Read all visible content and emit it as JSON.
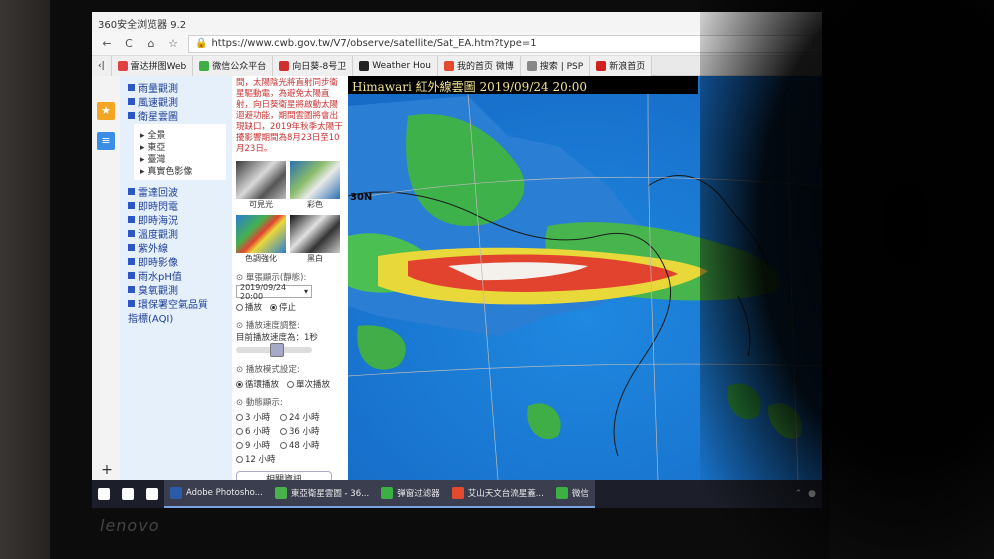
{
  "browser": {
    "title": "360安全浏览器 9.2",
    "url": "https://www.cwb.gov.tw/V7/observe/satellite/Sat_EA.htm?type=1",
    "nav_icons": [
      "back-icon",
      "refresh-icon",
      "home-icon",
      "star-icon"
    ],
    "tabs": [
      {
        "label": "雷达拼图Web",
        "color": "#e04040"
      },
      {
        "label": "微信公众平台",
        "color": "#3cb043"
      },
      {
        "label": "向日葵-8号卫",
        "color": "#d03030"
      },
      {
        "label": "Weather Hou",
        "color": "#222222"
      },
      {
        "label": "我的首页 微博",
        "color": "#e64a2e"
      },
      {
        "label": "搜索 | PSP",
        "color": "#888888"
      },
      {
        "label": "新浪首页",
        "color": "#d02020"
      }
    ]
  },
  "nav": {
    "items_top": [
      "雨量觀測",
      "風速觀測",
      "衛星雲圖"
    ],
    "sub_items": [
      "全景",
      "東亞",
      "臺灣",
      "真實色影像"
    ],
    "items_bottom": [
      "雷達回波",
      "即時閃電",
      "即時海況",
      "溫度觀測",
      "紫外線",
      "即時影像",
      "雨水pH值",
      "臭氧觀測",
      "環保署空氣品質"
    ],
    "items_tail": "指標(AQI)"
  },
  "controls": {
    "note": "間，太陽陰光將直射同步衛星驅動電，為避免太陽直射，向日葵衛星將啟動太陽迴避功能，期間雲圖將會出現缺口，2019年秋季太陽干擾影響期間為8月23日至10月23日。",
    "thumbs": [
      "可見光",
      "彩色",
      "色調強化",
      "黑白"
    ],
    "single_frame_label": "單張顯示(靜態):",
    "selected_time": "2019/09/24 20:00",
    "play_radio": "播放",
    "stop_radio": "停止",
    "speed_label": "播放速度調整:",
    "speed_text": "目前播放速度為：1秒",
    "speed_fraction": 0.55,
    "mode_label": "播放模式設定:",
    "mode_loop": "循環播放",
    "mode_once": "單次播放",
    "anim_label": "動態顯示:",
    "hours": [
      "3 小時",
      "24 小時",
      "6 小時",
      "36 小時",
      "9 小時",
      "48 小時",
      "12 小時"
    ],
    "related_label": "相關資訊"
  },
  "map": {
    "header": "Himawari   紅外線雲圖  2019/09/24   20:00",
    "lat_label": "30N"
  },
  "taskbar": {
    "items": [
      {
        "label": "",
        "icon": "windows-start-icon",
        "color": "#ffffff"
      },
      {
        "label": "",
        "icon": "search-icon",
        "color": "#ffffff"
      },
      {
        "label": "",
        "icon": "task-view-icon",
        "color": "#ffffff"
      },
      {
        "label": "Adobe Photosho...",
        "icon": "photoshop-icon",
        "color": "#2b5ba6"
      },
      {
        "label": "東亞衛星雲圖 - 36...",
        "icon": "browser-360-icon",
        "color": "#47b34a"
      },
      {
        "label": "弹窗过滤器",
        "icon": "popup-filter-icon",
        "color": "#3cb043"
      },
      {
        "label": "艾山天文台流星蓋...",
        "icon": "weibo-icon",
        "color": "#e64a2e"
      },
      {
        "label": "微信",
        "icon": "wechat-icon",
        "color": "#3cb043"
      }
    ]
  },
  "brand": "lenovo",
  "colors": {
    "nav_bg": "#e6f0fb",
    "link": "#1f3f9a",
    "note": "#cc3333",
    "ocean": "#1e7fd8"
  }
}
